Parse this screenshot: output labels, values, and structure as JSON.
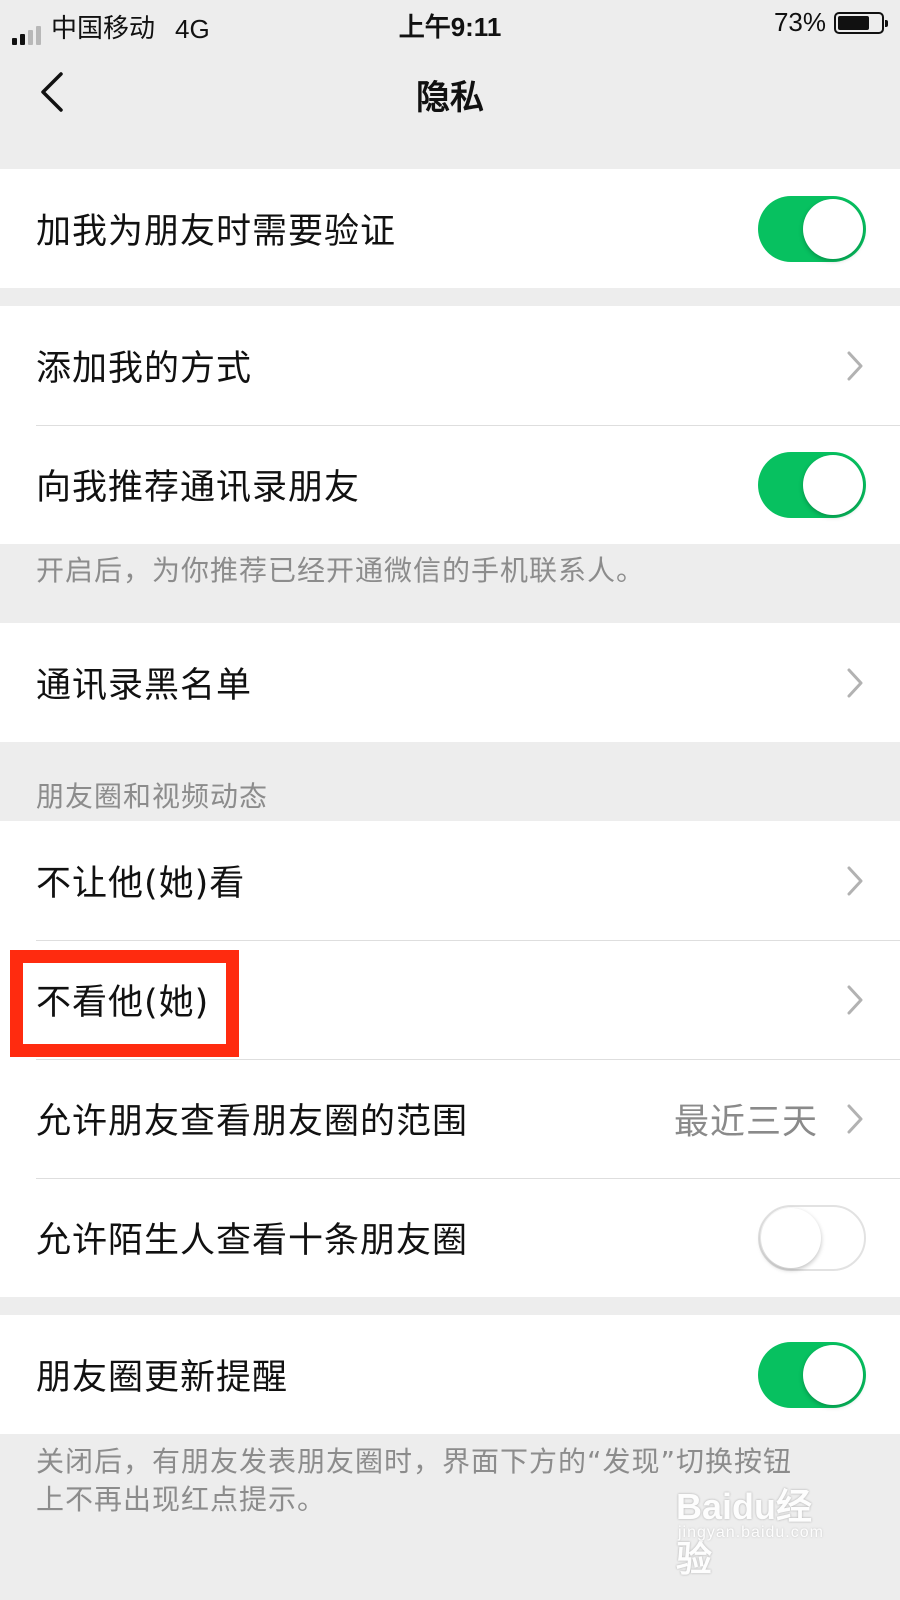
{
  "status_bar": {
    "carrier": "中国移动",
    "network": "4G",
    "time": "上午9:11",
    "battery_percent": "73%",
    "battery_level": 0.73
  },
  "nav": {
    "back_icon": "chevron-left-icon",
    "title": "隐私"
  },
  "groups": {
    "friend_verify": {
      "label": "加我为朋友时需要验证",
      "toggle_on": true
    },
    "add_me_ways": {
      "label": "添加我的方式"
    },
    "recommend_contacts": {
      "label": "向我推荐通讯录朋友",
      "toggle_on": true,
      "hint": "开启后，为你推荐已经开通微信的手机联系人。"
    },
    "contacts_blacklist": {
      "label": "通讯录黑名单"
    },
    "moments_section": {
      "header": "朋友圈和视频动态",
      "hide_my_posts": "不让他(她)看",
      "hide_their_posts": "不看他(她)",
      "visible_range": {
        "label": "允许朋友查看朋友圈的范围",
        "value": "最近三天"
      },
      "stranger_ten_posts": {
        "label": "允许陌生人查看十条朋友圈",
        "toggle_on": false
      }
    },
    "moments_update_reminder": {
      "label": "朋友圈更新提醒",
      "toggle_on": true,
      "hint_line1": "关闭后，有朋友发表朋友圈时，界面下方的“发现”切换按钮",
      "hint_line2": "上不再出现红点提示。"
    }
  },
  "colors": {
    "toggle_on": "#07c160",
    "highlight": "#ff2b0f",
    "background": "#ededed"
  },
  "watermark": {
    "main": "Baidu经验",
    "sub": "jingyan.baidu.com"
  }
}
